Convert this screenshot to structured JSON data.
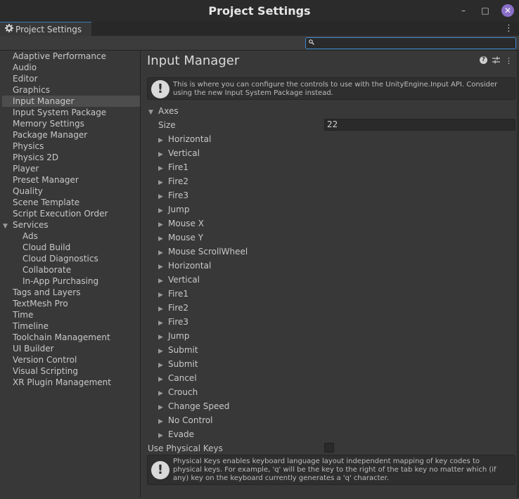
{
  "window": {
    "title": "Project Settings",
    "minimize": "–",
    "maximize": "□",
    "close": "✕"
  },
  "tab": {
    "icon": "gear-icon",
    "label": "Project Settings",
    "menu": "⋮"
  },
  "search": {
    "placeholder": "",
    "value": ""
  },
  "sidebar": {
    "items": [
      {
        "label": "Adaptive Performance"
      },
      {
        "label": "Audio"
      },
      {
        "label": "Editor"
      },
      {
        "label": "Graphics"
      },
      {
        "label": "Input Manager"
      },
      {
        "label": "Input System Package"
      },
      {
        "label": "Memory Settings"
      },
      {
        "label": "Package Manager"
      },
      {
        "label": "Physics"
      },
      {
        "label": "Physics 2D"
      },
      {
        "label": "Player"
      },
      {
        "label": "Preset Manager"
      },
      {
        "label": "Quality"
      },
      {
        "label": "Scene Template"
      },
      {
        "label": "Script Execution Order"
      },
      {
        "label": "Services"
      },
      {
        "label": "Ads"
      },
      {
        "label": "Cloud Build"
      },
      {
        "label": "Cloud Diagnostics"
      },
      {
        "label": "Collaborate"
      },
      {
        "label": "In-App Purchasing"
      },
      {
        "label": "Tags and Layers"
      },
      {
        "label": "TextMesh Pro"
      },
      {
        "label": "Time"
      },
      {
        "label": "Timeline"
      },
      {
        "label": "Toolchain Management"
      },
      {
        "label": "UI Builder"
      },
      {
        "label": "Version Control"
      },
      {
        "label": "Visual Scripting"
      },
      {
        "label": "XR Plugin Management"
      }
    ],
    "selected": "Input Manager"
  },
  "main": {
    "title": "Input Manager",
    "info_message": "This is where you can configure the controls to use with the UnityEngine.Input API. Consider using the new Input System Package instead.",
    "axes_label": "Axes",
    "size_label": "Size",
    "size_value": "22",
    "axes": [
      "Horizontal",
      "Vertical",
      "Fire1",
      "Fire2",
      "Fire3",
      "Jump",
      "Mouse X",
      "Mouse Y",
      "Mouse ScrollWheel",
      "Horizontal",
      "Vertical",
      "Fire1",
      "Fire2",
      "Fire3",
      "Jump",
      "Submit",
      "Submit",
      "Cancel",
      "Crouch",
      "Change Speed",
      "No Control",
      "Evade"
    ],
    "physical_keys_label": "Use Physical Keys",
    "physical_keys_checked": false,
    "physical_keys_message": "Physical Keys enables keyboard language layout independent mapping of key codes to physical keys. For example, 'q' will be the key to the right of the tab key no matter which (if any) key on the keyboard currently generates a 'q' character."
  }
}
